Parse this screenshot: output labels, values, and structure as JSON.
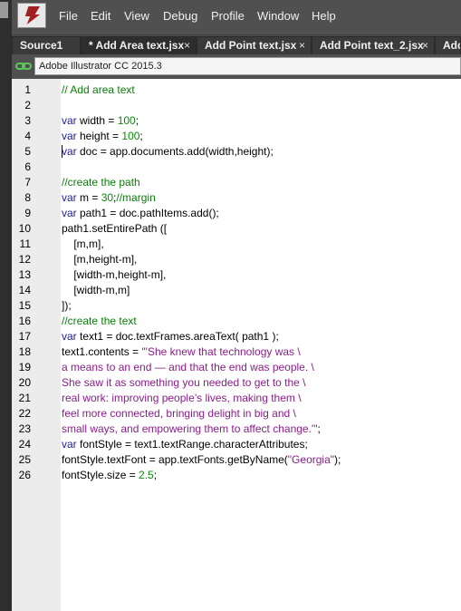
{
  "menu": [
    "File",
    "Edit",
    "View",
    "Debug",
    "Profile",
    "Window",
    "Help"
  ],
  "tabs": [
    {
      "label": "Source1",
      "active": false
    },
    {
      "label": "* Add Area text.jsx",
      "active": true
    },
    {
      "label": "Add Point text.jsx",
      "active": false
    },
    {
      "label": "Add Point text_2.jsx",
      "active": false
    },
    {
      "label": "Add",
      "active": false
    }
  ],
  "tab_close_glyph": "×",
  "target": {
    "app": "Adobe Illustrator CC 2015.3"
  },
  "icons": {
    "app_logo": "extendscript-toolkit-logo-icon",
    "link": "chain-link-icon",
    "close": "close-icon"
  },
  "colors": {
    "keyword": "#1a1aa6",
    "number": "#0a8a0a",
    "comment": "#0b7d0b",
    "string": "#8a1e8a"
  },
  "editor": {
    "lines": [
      [
        [
          "// Add area text",
          "cm"
        ]
      ],
      [],
      [
        [
          "var",
          "kw"
        ],
        [
          " width = ",
          ""
        ],
        [
          "100",
          "num"
        ],
        [
          ";",
          ""
        ]
      ],
      [
        [
          "var",
          "kw"
        ],
        [
          " height = ",
          ""
        ],
        [
          "100",
          "num"
        ],
        [
          ";",
          ""
        ]
      ],
      [
        [
          "var",
          "kw"
        ],
        [
          " doc = app.documents.add(width,height);",
          ""
        ]
      ],
      [],
      [
        [
          "//create the path",
          "cm"
        ]
      ],
      [
        [
          "var",
          "kw"
        ],
        [
          " m = ",
          ""
        ],
        [
          "30",
          "num"
        ],
        [
          ";",
          ""
        ],
        [
          "//margin",
          "cm"
        ]
      ],
      [
        [
          "var",
          "kw"
        ],
        [
          " path1 = doc.pathItems.add();",
          ""
        ]
      ],
      [
        [
          "path1.setEntirePath ([",
          ""
        ]
      ],
      [
        [
          "    [m,m],",
          ""
        ]
      ],
      [
        [
          "    [m,height-m],",
          ""
        ]
      ],
      [
        [
          "    [width-m,height-m],",
          ""
        ]
      ],
      [
        [
          "    [width-m,m]",
          ""
        ]
      ],
      [
        [
          "]);",
          ""
        ]
      ],
      [
        [
          "//create the text",
          "cm"
        ]
      ],
      [
        [
          "var",
          "kw"
        ],
        [
          " text1 = doc.textFrames.areaText( path1 );",
          ""
        ]
      ],
      [
        [
          "text1.contents = ",
          ""
        ],
        [
          "\"'She knew that technology was \\",
          "str"
        ]
      ],
      [
        [
          "a means to an end — and that the end was people. \\",
          "str"
        ]
      ],
      [
        [
          "She saw it as something you needed to get to the \\",
          "str"
        ]
      ],
      [
        [
          "real work: improving people’s lives, making them \\",
          "str"
        ]
      ],
      [
        [
          "feel more connected, bringing delight in big and \\",
          "str"
        ]
      ],
      [
        [
          "small ways, and empowering them to affect change.'\"",
          "str"
        ],
        [
          ";",
          ""
        ]
      ],
      [
        [
          "var",
          "kw"
        ],
        [
          " fontStyle = text1.textRange.characterAttributes;",
          ""
        ]
      ],
      [
        [
          "fontStyle.textFont = app.textFonts.getByName(",
          ""
        ],
        [
          "\"Georgia\"",
          "str"
        ],
        [
          ");",
          ""
        ]
      ],
      [
        [
          "fontStyle.size = ",
          ""
        ],
        [
          "2.5",
          "num"
        ],
        [
          ";",
          ""
        ]
      ]
    ]
  }
}
